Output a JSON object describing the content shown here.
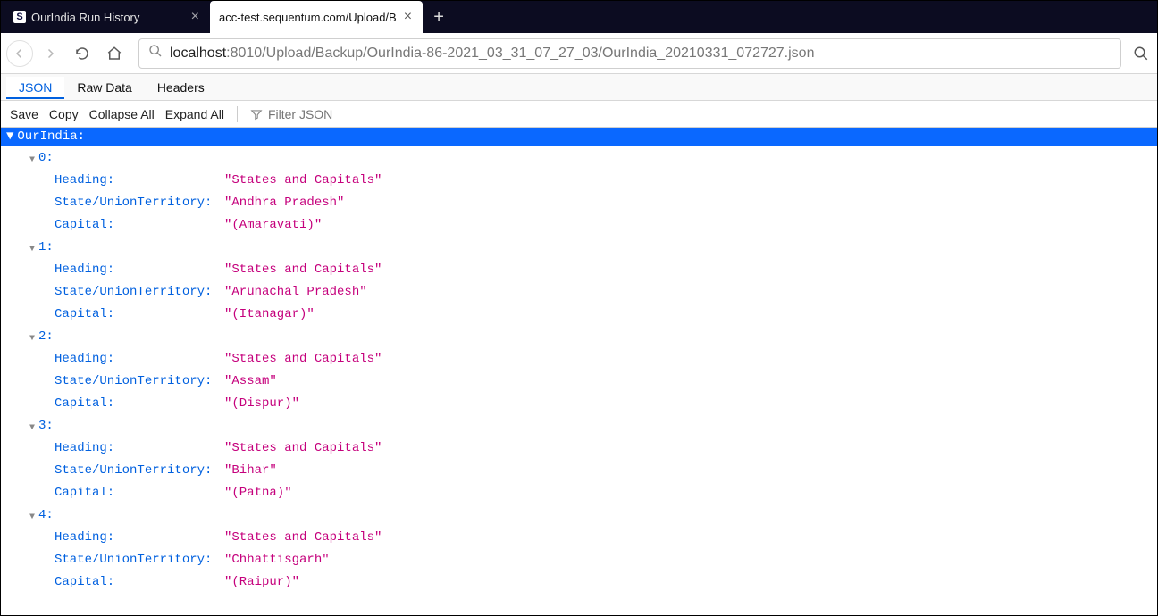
{
  "tabs": [
    {
      "title": "OurIndia Run History",
      "active": false,
      "favicon": "S"
    },
    {
      "title": "acc-test.sequentum.com/Upload/B",
      "active": true,
      "favicon": ""
    }
  ],
  "newtab_glyph": "+",
  "url": {
    "host": "localhost",
    "path": ":8010/Upload/Backup/OurIndia-86-2021_03_31_07_27_03/OurIndia_20210331_072727.json"
  },
  "viewer_tabs": {
    "json": "JSON",
    "raw": "Raw Data",
    "headers": "Headers"
  },
  "toolbar": {
    "save": "Save",
    "copy": "Copy",
    "collapse": "Collapse All",
    "expand": "Expand All",
    "filter_placeholder": "Filter JSON"
  },
  "root_key": "OurIndia",
  "colon": ":",
  "fields": {
    "heading": "Heading",
    "state": "State/UnionTerritory",
    "capital": "Capital"
  },
  "items": [
    {
      "Heading": "States and Capitals",
      "State": "Andhra Pradesh",
      "Capital": "(Amaravati)"
    },
    {
      "Heading": "States and Capitals",
      "State": "Arunachal Pradesh",
      "Capital": "(Itanagar)"
    },
    {
      "Heading": "States and Capitals",
      "State": "Assam",
      "Capital": "(Dispur)"
    },
    {
      "Heading": "States and Capitals",
      "State": "Bihar",
      "Capital": "(Patna)"
    },
    {
      "Heading": "States and Capitals",
      "State": "Chhattisgarh",
      "Capital": "(Raipur)"
    }
  ]
}
